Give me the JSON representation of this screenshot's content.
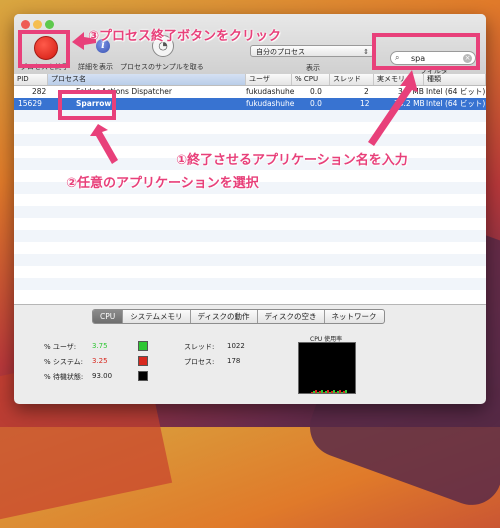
{
  "toolbar": {
    "quit_label": "プロセスを終了",
    "info_label": "詳細を表示",
    "sample_label": "プロセスのサンプルを取る",
    "filter_value": "自分のプロセス",
    "display_label": "表示",
    "search_value": "spa",
    "filter_label": "フィルタ"
  },
  "columns": [
    "PID",
    "プロセス名",
    "ユーザ",
    "% CPU",
    "スレッド",
    "実メモリ",
    "種類"
  ],
  "rows": [
    {
      "pid": "282",
      "name": "Folder Actions Dispatcher",
      "user": "fukudashuhe",
      "cpu": "0.0",
      "threads": "2",
      "mem": "3.6 MB",
      "kind": "Intel (64 ビット)"
    },
    {
      "pid": "15629",
      "name": "Sparrow",
      "user": "fukudashuhe",
      "cpu": "0.0",
      "threads": "12",
      "mem": "34.2 MB",
      "kind": "Intel (64 ビット)"
    }
  ],
  "tabs": [
    "CPU",
    "システムメモリ",
    "ディスクの動作",
    "ディスクの空き",
    "ネットワーク"
  ],
  "stats": {
    "user_label": "% ユーザ:",
    "user_value": "3.75",
    "user_color": "#2ec633",
    "system_label": "% システム:",
    "system_value": "3.25",
    "system_color": "#d7281e",
    "idle_label": "% 待機状態:",
    "idle_value": "93.00",
    "idle_color": "#000000",
    "threads_label": "スレッド:",
    "threads_value": "1022",
    "process_label": "プロセス:",
    "process_value": "178",
    "graph_title": "CPU 使用率"
  },
  "annotations": {
    "step3": "③プロセス終了ボタンをクリック",
    "step1": "①終了させるアプリケーション名を入力",
    "step2": "②任意のアプリケーションを選択",
    "accent": "#e8407a"
  }
}
